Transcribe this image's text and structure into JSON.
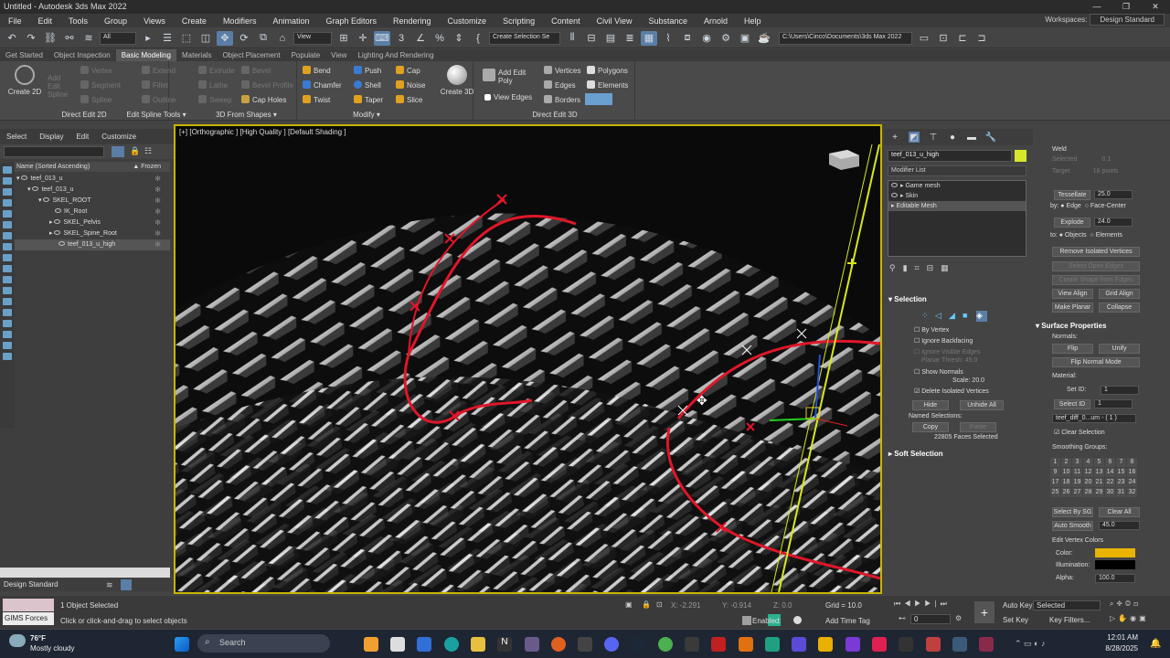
{
  "window": {
    "title": "Untitled - Autodesk 3ds Max 2022",
    "controls": [
      "—",
      "❐",
      "✕"
    ]
  },
  "menu": [
    "File",
    "Edit",
    "Tools",
    "Group",
    "Views",
    "Create",
    "Modifiers",
    "Animation",
    "Graph Editors",
    "Rendering",
    "Customize",
    "Scripting",
    "Content",
    "Civil View",
    "Substance",
    "Arnold",
    "Help"
  ],
  "workspaces": {
    "label": "Workspaces:",
    "value": "Design Standard"
  },
  "toolbar": {
    "filter": "All",
    "view": "View",
    "selset": "Create Selection Se",
    "path": "C:\\Users\\Cinco\\Documents\\3ds Max 2022"
  },
  "ribbon_tabs": [
    "Get Started",
    "Object Inspection",
    "Basic Modeling",
    "Materials",
    "Object Placement",
    "Populate",
    "View",
    "Lighting And Rendering"
  ],
  "ribbon": {
    "create2d": "Create 2D",
    "vertex": "Vertex",
    "segment": "Segment",
    "spline": "Spline",
    "extend": "Extend",
    "fillet": "Fillet",
    "outline": "Outline",
    "adv_edit": "Add Edit Spline",
    "extrude": "Extrude",
    "lathe": "Lathe",
    "sweep": "Sweep",
    "bevel": "Bevel",
    "bevel_profile": "Bevel Profile",
    "cap_holes": "Cap Holes",
    "bend": "Bend",
    "chamfer": "Chamfer",
    "twist": "Twist",
    "push": "Push",
    "shell": "Shell",
    "taper": "Taper",
    "cap": "Cap",
    "noise": "Noise",
    "slice": "Slice",
    "create3d": "Create 3D",
    "add_edit_poly": "Add Edit Poly",
    "view_edges": "View Edges",
    "vertices": "Vertices",
    "edges": "Edges",
    "borders": "Borders",
    "polygons": "Polygons",
    "elements": "Elements",
    "g1": "Direct Edit 2D",
    "g2": "Edit Spline Tools",
    "g3": "3D From Shapes",
    "g4": "Modify",
    "g5": "Direct Edit 3D"
  },
  "scene": {
    "tabs": [
      "Select",
      "Display",
      "Edit",
      "Customize"
    ],
    "col_name": "Name (Sorted Ascending)",
    "col_frozen": "▲ Frozen",
    "items": [
      {
        "label": "teef_013_u"
      },
      {
        "label": "teef_013_u"
      },
      {
        "label": "SKEL_ROOT"
      },
      {
        "label": "IK_Root"
      },
      {
        "label": "SKEL_Pelvis"
      },
      {
        "label": "SKEL_Spine_Root"
      },
      {
        "label": "teef_013_u_high"
      }
    ],
    "workspace": "Design Standard"
  },
  "viewport": {
    "label": "[+] [Orthographic ] [High Quality ] [Default Shading ]"
  },
  "command": {
    "object_name": "teef_013_u_high",
    "modifier_list": "Modifier List",
    "stack": [
      "Game mesh",
      "Skin",
      "Editable Mesh"
    ],
    "selection": "Selection",
    "by_vertex": "By Vertex",
    "ignore_backfacing": "Ignore Backfacing",
    "ignore_visible": "Ignore Visible Edges",
    "planar_thresh": "Planar Thresh:",
    "planar_val": "45.0",
    "show_normals": "Show Normals",
    "scale": "Scale:",
    "scale_val": "20.0",
    "delete_iso": "Delete Isolated Vertices",
    "hide": "Hide",
    "unhide_all": "Unhide All",
    "named_sel": "Named Selections:",
    "copy": "Copy",
    "paste": "Paste",
    "faces_sel": "22805 Faces Selected",
    "soft_sel": "Soft Selection"
  },
  "edit": {
    "weld": "Weld",
    "selected": "Selected",
    "selected_val": "0.1",
    "target": "Target",
    "target_val": "16",
    "pixels": "pixels",
    "tessellate": "Tessellate",
    "tess_val": "25.0",
    "by": "by:",
    "edge": "Edge",
    "face_center": "Face-Center",
    "explode": "Explode",
    "explode_val": "24.0",
    "to": "to:",
    "objects": "Objects",
    "elements": "Elements",
    "remove_iso": "Remove Isolated Vertices",
    "select_open": "Select Open Edges",
    "create_shape": "Create Shape from Edges",
    "view_align": "View Align",
    "grid_align": "Grid Align",
    "make_planar": "Make Planar",
    "collapse": "Collapse",
    "surface": "Surface Properties",
    "normals": "Normals:",
    "flip": "Flip",
    "unify": "Unify",
    "flip_mode": "Flip Normal Mode",
    "material": "Material:",
    "set_id": "Set ID:",
    "set_id_val": "1",
    "select_id": "Select ID",
    "select_id_val": "1",
    "mat_name": "teef_diff_0...um - ( 1 )",
    "clear_sel": "Clear Selection",
    "smoothing": "Smoothing Groups:",
    "sg": [
      "1",
      "2",
      "3",
      "4",
      "5",
      "6",
      "7",
      "8",
      "9",
      "10",
      "11",
      "12",
      "13",
      "14",
      "15",
      "16",
      "17",
      "18",
      "19",
      "20",
      "21",
      "22",
      "23",
      "24",
      "25",
      "26",
      "27",
      "28",
      "29",
      "30",
      "31",
      "32"
    ],
    "select_by_sg": "Select By SG",
    "clear_all": "Clear All",
    "auto_smooth": "Auto Smooth",
    "auto_val": "45.0",
    "vcolors": "Edit Vertex Colors",
    "color": "Color:",
    "illum": "Illumination:",
    "alpha": "Alpha:",
    "alpha_val": "100.0",
    "color_hex": "#e8b400",
    "illum_hex": "#000000"
  },
  "status": {
    "objects": "1 Object Selected",
    "hint": "Click or click-and-drag to select objects",
    "x": "X: -2.291",
    "y": "Y: -0.914",
    "z": "Z: 0.0",
    "grid": "Grid = 10.0",
    "enabled": "Enabled:",
    "add_time_tag": "Add Time Tag",
    "autokey": "Auto Key",
    "setkey": "Set Key",
    "selected": "Selected",
    "keyfilters": "Key Filters...",
    "frame": "0",
    "gims": "GIMS Forces"
  },
  "taskbar": {
    "weather_temp": "76°F",
    "weather_desc": "Mostly cloudy",
    "search": "Search",
    "time": "12:01 AM",
    "date": "8/28/2025"
  }
}
